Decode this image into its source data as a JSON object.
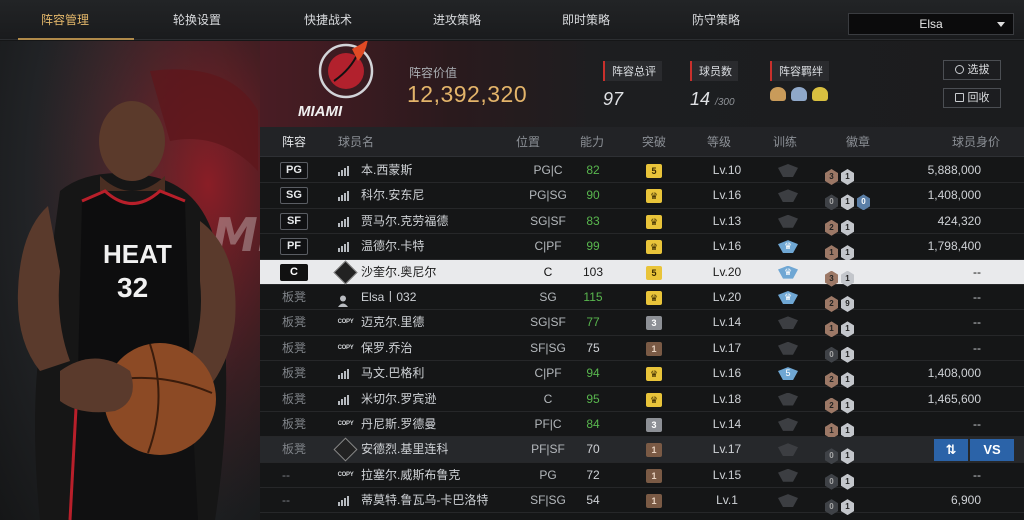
{
  "nav": {
    "tabs": [
      "阵容管理",
      "轮换设置",
      "快捷战术",
      "进攻策略",
      "即时策略",
      "防守策略"
    ],
    "user": "Elsa"
  },
  "header": {
    "team_logo_text": "MIAMI",
    "value_label": "阵容价值",
    "value": "12,392,320",
    "rating_label": "阵容总评",
    "rating": "97",
    "count_label": "球员数",
    "count": "14",
    "count_max": "/300",
    "bond_label": "阵容羁绊",
    "btn_pick": "选拔",
    "btn_recycle": "回收"
  },
  "hero": {
    "jersey_team": "HEAT",
    "jersey_number": "32"
  },
  "table": {
    "headers": [
      "阵容",
      "球员名",
      "位置",
      "能力",
      "突破",
      "等级",
      "训练",
      "徽章",
      "球员身价"
    ],
    "rows": [
      {
        "slot": "PG",
        "name": "本.西蒙斯",
        "pos": "PG|C",
        "ability": "82",
        "break": "5",
        "break_type": "y",
        "level": "Lv.10",
        "train": "",
        "badges": [
          "3",
          "1"
        ],
        "worth": "5,888,000",
        "icon": "bars"
      },
      {
        "slot": "SG",
        "name": "科尔.安东尼",
        "pos": "PG|SG",
        "ability": "90",
        "break": "♛",
        "break_type": "y",
        "level": "Lv.16",
        "train": "",
        "badges": [
          "0",
          "1",
          "0"
        ],
        "worth": "1,408,000",
        "icon": "bars"
      },
      {
        "slot": "SF",
        "name": "贾马尔.克劳福德",
        "pos": "SG|SF",
        "ability": "83",
        "break": "♛",
        "break_type": "y",
        "level": "Lv.13",
        "train": "",
        "badges": [
          "2",
          "1"
        ],
        "worth": "424,320",
        "icon": "bars"
      },
      {
        "slot": "PF",
        "name": "温德尔.卡特",
        "pos": "C|PF",
        "ability": "99",
        "break": "♛",
        "break_type": "y",
        "level": "Lv.16",
        "train": "♛",
        "badges": [
          "1",
          "1"
        ],
        "worth": "1,798,400",
        "icon": "bars"
      },
      {
        "slot": "C",
        "name": "沙奎尔.奥尼尔",
        "pos": "C",
        "ability": "103",
        "break": "5",
        "break_type": "y",
        "level": "Lv.20",
        "train": "♛",
        "badges": [
          "3",
          "1"
        ],
        "worth": "--",
        "icon": "copyd"
      },
      {
        "slot": "板凳",
        "name": "Elsa丨032",
        "pos": "SG",
        "ability": "115",
        "break": "♛",
        "break_type": "y",
        "level": "Lv.20",
        "train": "♛",
        "badges": [
          "2",
          "9"
        ],
        "worth": "--",
        "icon": "person"
      },
      {
        "slot": "板凳",
        "name": "迈克尔.里德",
        "pos": "SG|SF",
        "ability": "77",
        "break": "3",
        "break_type": "s",
        "level": "Lv.14",
        "train": "",
        "badges": [
          "1",
          "1"
        ],
        "worth": "--",
        "icon": "copy"
      },
      {
        "slot": "板凳",
        "name": "保罗.乔治",
        "pos": "SF|SG",
        "ability": "75",
        "break": "1",
        "break_type": "b",
        "level": "Lv.17",
        "train": "",
        "badges": [
          "0",
          "1"
        ],
        "worth": "--",
        "icon": "copy"
      },
      {
        "slot": "板凳",
        "name": "马文.巴格利",
        "pos": "C|PF",
        "ability": "94",
        "break": "♛",
        "break_type": "y",
        "level": "Lv.16",
        "train": "5",
        "badges": [
          "2",
          "1"
        ],
        "worth": "1,408,000",
        "icon": "bars"
      },
      {
        "slot": "板凳",
        "name": "米切尔.罗宾逊",
        "pos": "C",
        "ability": "95",
        "break": "♛",
        "break_type": "y",
        "level": "Lv.18",
        "train": "",
        "badges": [
          "2",
          "1"
        ],
        "worth": "1,465,600",
        "icon": "bars"
      },
      {
        "slot": "板凳",
        "name": "丹尼斯.罗德曼",
        "pos": "PF|C",
        "ability": "84",
        "break": "3",
        "break_type": "s",
        "level": "Lv.14",
        "train": "",
        "badges": [
          "1",
          "1"
        ],
        "worth": "--",
        "icon": "copy"
      },
      {
        "slot": "板凳",
        "name": "安德烈.基里连科",
        "pos": "PF|SF",
        "ability": "70",
        "break": "1",
        "break_type": "b",
        "level": "Lv.17",
        "train": "",
        "badges": [
          "0",
          "1"
        ],
        "worth": "",
        "icon": "copyd"
      },
      {
        "slot": "--",
        "name": "拉塞尔.威斯布鲁克",
        "pos": "PG",
        "ability": "72",
        "break": "1",
        "break_type": "b",
        "level": "Lv.15",
        "train": "",
        "badges": [
          "0",
          "1"
        ],
        "worth": "--",
        "icon": "copy"
      },
      {
        "slot": "--",
        "name": "蒂莫特.鲁瓦乌-卡巴洛特",
        "pos": "SF|SG",
        "ability": "54",
        "break": "1",
        "break_type": "b",
        "level": "Lv.1",
        "train": "",
        "badges": [
          "0",
          "1"
        ],
        "worth": "6,900",
        "icon": "bars"
      }
    ]
  },
  "swap": {
    "vs": "VS",
    "swap_glyph": "⇅"
  },
  "colors": {
    "accent": "#e3b46a",
    "green": "#59b74e",
    "badge_yellow": "#e9c43a",
    "blue": "#2b63a8"
  }
}
